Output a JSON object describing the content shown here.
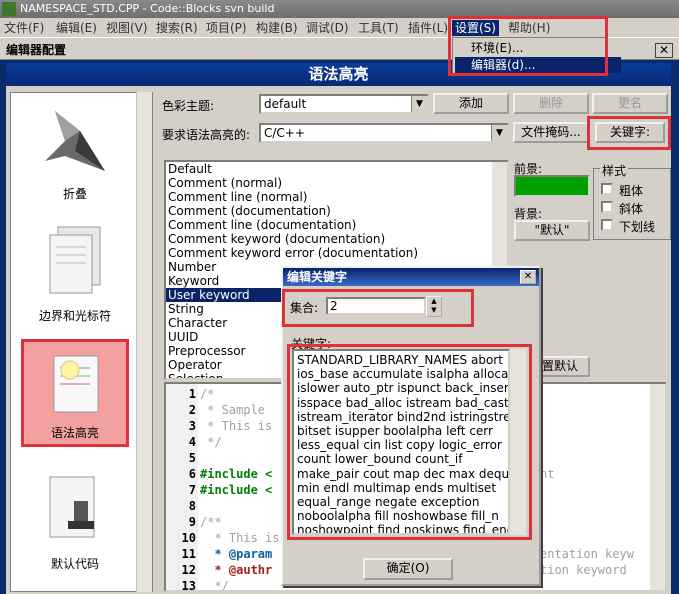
{
  "window": {
    "title": "NAMESPACE_STD.CPP - Code::Blocks svn build"
  },
  "menu": {
    "items": [
      "文件(F)",
      "编辑(E)",
      "视图(V)",
      "搜索(R)",
      "项目(P)",
      "构建(B)",
      "调试(D)",
      "工具(T)",
      "插件(L)",
      "设置(S)",
      "帮助(H)"
    ],
    "dropdown": [
      "环境(E)...",
      "编辑器(d)..."
    ]
  },
  "dialog": {
    "title": "编辑器配置",
    "close": "✕",
    "header": "语法高亮",
    "left_items": [
      "折叠",
      "边界和光标符",
      "语法高亮",
      "默认代码"
    ],
    "scheme_label": "色彩主题:",
    "scheme_value": "default",
    "lang_label": "要求语法高亮的:",
    "lang_value": "C/C++",
    "buttons": {
      "add": "添加",
      "delete": "删除",
      "rename": "更名",
      "filemasks": "文件掩码...",
      "keywords": "关键字:",
      "default": "\"默认\"",
      "reset": "置默认"
    },
    "fg_label": "前景:",
    "bg_label": "背景:",
    "style_group": "样式",
    "style_bold": "粗体",
    "style_italic": "斜体",
    "style_underline": "下划线",
    "style_list": [
      "Default",
      "Comment (normal)",
      "Comment line (normal)",
      "Comment (documentation)",
      "Comment line (documentation)",
      "Comment keyword (documentation)",
      "Comment keyword error (documentation)",
      "Number",
      "Keyword",
      "User keyword",
      "String",
      "Character",
      "UUID",
      "Preprocessor",
      "Operator",
      "Selection"
    ],
    "selected_style": "User keyword",
    "code_lines": [
      {
        "n": "1",
        "text": "/*"
      },
      {
        "n": "2",
        "text": " * Sample"
      },
      {
        "n": "3",
        "text": " * This is"
      },
      {
        "n": "4",
        "text": " */"
      },
      {
        "n": "5",
        "text": ""
      },
      {
        "n": "6",
        "text": "#include <"
      },
      {
        "n": "7",
        "text": "#include <"
      },
      {
        "n": "8",
        "text": ""
      },
      {
        "n": "9",
        "text": "/**"
      },
      {
        "n": "10",
        "text": "  * This is"
      },
      {
        "n": "11",
        "text": "  * @param"
      },
      {
        "n": "12",
        "text": "  * @authr"
      },
      {
        "n": "13",
        "text": "  */"
      }
    ],
    "code_right_fragments": [
      "nt",
      "entation keyw",
      "tion keyword"
    ]
  },
  "popup": {
    "title": "编辑关键字",
    "close": "✕",
    "set_label": "集合:",
    "set_value": "2",
    "keywords_label": "关键字:",
    "keywords_lines": [
      "STANDARD_LIBRARY_NAMES abort",
      "ios_base accumulate isalpha allocator",
      "islower auto_ptr ispunct back_inserter",
      "isspace bad_alloc istream bad_cast",
      "istream_iterator bind2nd istringstream",
      "bitset isupper boolalpha left cerr",
      "less_equal cin list copy logic_error",
      "count lower_bound count_if",
      "make_pair cout map dec max deque",
      "min endl multimap ends multiset",
      "equal_range negate exception",
      "noboolalpha fill noshowbase fill_n",
      "noshowpoint find noskipws find_end"
    ],
    "ok": "确定(O)"
  }
}
